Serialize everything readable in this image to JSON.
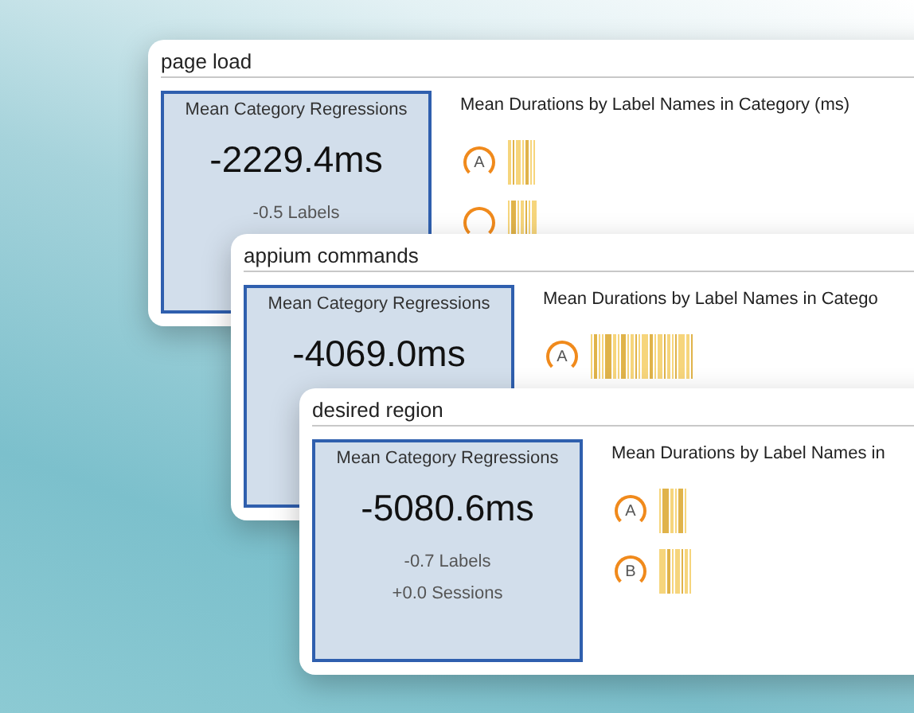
{
  "panels": [
    {
      "title": "page load",
      "kpi": {
        "label": "Mean Category Regressions",
        "value": "-2229.4ms",
        "stats": [
          "-0.5 Labels"
        ]
      },
      "chart_title": "Mean Durations by Label Names in Category (ms)",
      "rows": [
        {
          "badge": "A"
        },
        {}
      ]
    },
    {
      "title": "appium commands",
      "kpi": {
        "label": "Mean Category Regressions",
        "value": "-4069.0ms"
      },
      "chart_title": "Mean Durations by Label Names in Catego",
      "rows": [
        {
          "badge": "A"
        }
      ]
    },
    {
      "title": "desired region",
      "kpi": {
        "label": "Mean Category Regressions",
        "value": "-5080.6ms",
        "stats": [
          "-0.7 Labels",
          "+0.0 Sessions"
        ]
      },
      "chart_title": "Mean Durations by Label Names in",
      "rows": [
        {
          "badge": "A"
        },
        {
          "badge": "B"
        }
      ]
    }
  ]
}
